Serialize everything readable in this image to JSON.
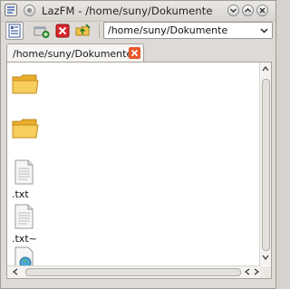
{
  "window": {
    "title": "LazFM - /home/suny/Dokumente"
  },
  "toolbar": {
    "path_value": "/home/suny/Dokumente"
  },
  "tabs": [
    {
      "label": "/home/suny/Dokumente"
    }
  ],
  "files": [
    {
      "name": "",
      "icon": "folder-icon"
    },
    {
      "name": "",
      "icon": "folder-icon"
    },
    {
      "name": ".txt",
      "icon": "text-file-icon"
    },
    {
      "name": ".txt~",
      "icon": "text-file-icon"
    },
    {
      "name": "",
      "icon": "globe-file-icon"
    }
  ],
  "colors": {
    "folder": "#f3c24b",
    "close_red": "#d9252a",
    "tab_close": "#e8582a"
  }
}
